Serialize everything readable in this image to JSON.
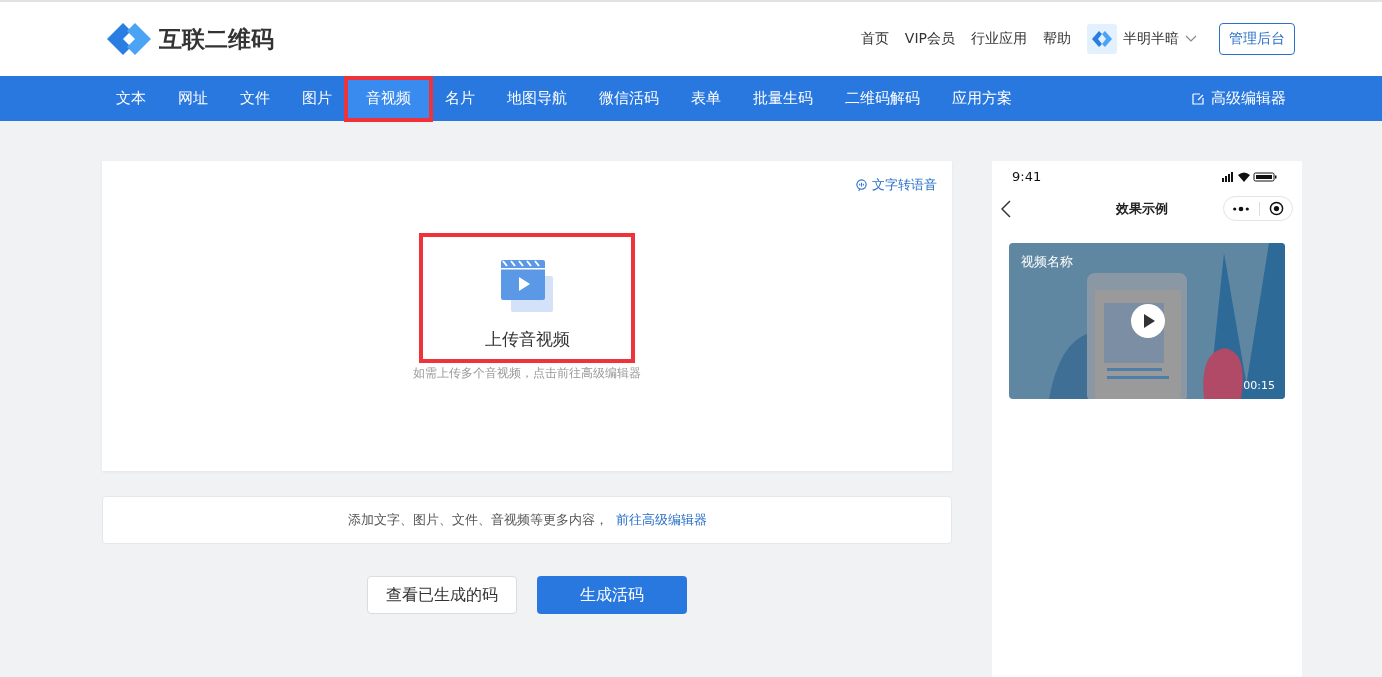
{
  "header": {
    "brand": "互联二维码",
    "links": [
      "首页",
      "VIP会员",
      "行业应用",
      "帮助"
    ],
    "user": {
      "name": "半明半暗"
    },
    "admin_button": "管理后台"
  },
  "nav": {
    "items": [
      {
        "label": "文本",
        "selected": false,
        "highlighted": false
      },
      {
        "label": "网址",
        "selected": false,
        "highlighted": false
      },
      {
        "label": "文件",
        "selected": false,
        "highlighted": false
      },
      {
        "label": "图片",
        "selected": false,
        "highlighted": false
      },
      {
        "label": "音视频",
        "selected": true,
        "highlighted": true
      },
      {
        "label": "名片",
        "selected": false,
        "highlighted": false
      },
      {
        "label": "地图导航",
        "selected": false,
        "highlighted": false
      },
      {
        "label": "微信活码",
        "selected": false,
        "highlighted": false
      },
      {
        "label": "表单",
        "selected": false,
        "highlighted": false
      },
      {
        "label": "批量生码",
        "selected": false,
        "highlighted": false
      },
      {
        "label": "二维码解码",
        "selected": false,
        "highlighted": false
      },
      {
        "label": "应用方案",
        "selected": false,
        "highlighted": false
      }
    ],
    "editor_link": "高级编辑器"
  },
  "upload": {
    "tts_link": "文字转语音",
    "label": "上传音视频",
    "highlighted": true,
    "hint": "如需上传多个音视频，点击前往高级编辑器"
  },
  "more_bar": {
    "text": "添加文字、图片、文件、音视频等更多内容，",
    "link": "前往高级编辑器"
  },
  "buttons": [
    {
      "label": "查看已生成的码",
      "kind": "secondary"
    },
    {
      "label": "生成活码",
      "kind": "primary"
    }
  ],
  "preview": {
    "time": "9:41",
    "title": "效果示例",
    "video": {
      "kind": "picture",
      "name": "视频名称",
      "duration": "00:15"
    }
  }
}
